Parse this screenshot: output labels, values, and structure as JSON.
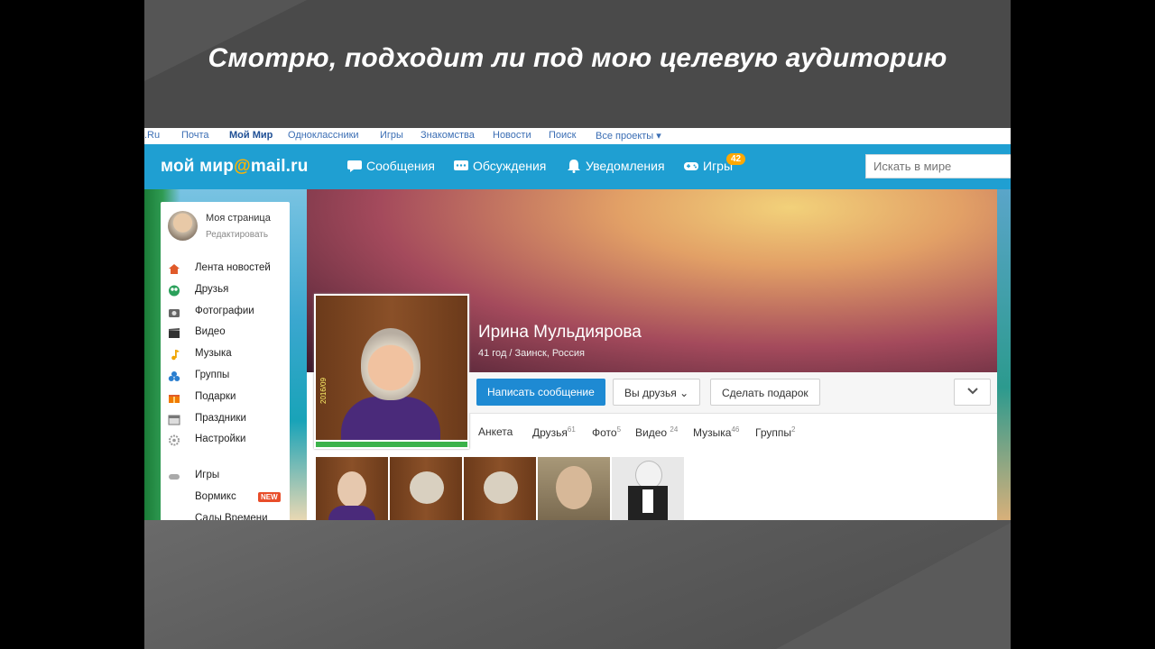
{
  "slide": {
    "title": "Смотрю, подходит ли под мою целевую аудиторию"
  },
  "topnav": {
    "items": [
      {
        "label": ".Ru"
      },
      {
        "label": "Почта"
      },
      {
        "label": "Мой Мир"
      },
      {
        "label": "Одноклассники"
      },
      {
        "label": "Игры"
      },
      {
        "label": "Знакомства"
      },
      {
        "label": "Новости"
      },
      {
        "label": "Поиск"
      },
      {
        "label": "Все проекты ▾"
      }
    ]
  },
  "header": {
    "logo_text": "мой мир",
    "logo_at": "@",
    "logo_domain": "mail.ru",
    "nav": [
      {
        "label": "Сообщения",
        "icon": "chat-icon"
      },
      {
        "label": "Обсуждения",
        "icon": "discussion-icon"
      },
      {
        "label": "Уведомления",
        "icon": "bell-icon"
      },
      {
        "label": "Игры",
        "icon": "gamepad-icon"
      }
    ],
    "games_badge": "42",
    "search_placeholder": "Искать в мире",
    "accent_color": "#1f9fd2"
  },
  "sidebar": {
    "my_page": "Моя страница",
    "edit": "Редактировать",
    "items": [
      {
        "label": "Лента новостей",
        "icon": "home-icon",
        "color": "#e05a2a"
      },
      {
        "label": "Друзья",
        "icon": "friends-icon",
        "color": "#2aa05a"
      },
      {
        "label": "Фотографии",
        "icon": "camera-icon",
        "color": "#666666"
      },
      {
        "label": "Видео",
        "icon": "clapper-icon",
        "color": "#333333"
      },
      {
        "label": "Музыка",
        "icon": "music-icon",
        "color": "#f0a500"
      },
      {
        "label": "Группы",
        "icon": "groups-icon",
        "color": "#2b7fd0"
      },
      {
        "label": "Подарки",
        "icon": "gift-icon",
        "color": "#f07a00"
      },
      {
        "label": "Праздники",
        "icon": "calendar-icon",
        "color": "#777777"
      },
      {
        "label": "Настройки",
        "icon": "gear-icon",
        "color": "#999999"
      },
      {
        "label": "Игры",
        "icon": "gamepad-icon",
        "color": "#888888"
      },
      {
        "label": "Вормикс",
        "icon": "",
        "color": ""
      },
      {
        "label": "Сады Времени",
        "icon": "",
        "color": ""
      }
    ],
    "new_badge": "NEW"
  },
  "profile": {
    "name": "Ирина Мульдиярова",
    "info": "41 год / Заинск, Россия",
    "photo_date": "2016/09",
    "buttons": {
      "message": "Написать сообщение",
      "friends": "Вы друзья ⌄",
      "gift": "Сделать подарок"
    },
    "tabs": [
      {
        "label": "Анкета",
        "count": ""
      },
      {
        "label": "Друзья",
        "count": "61"
      },
      {
        "label": "Фото",
        "count": "5"
      },
      {
        "label": "Видео",
        "count": "24"
      },
      {
        "label": "Музыка",
        "count": "46"
      },
      {
        "label": "Группы",
        "count": "2"
      }
    ]
  }
}
